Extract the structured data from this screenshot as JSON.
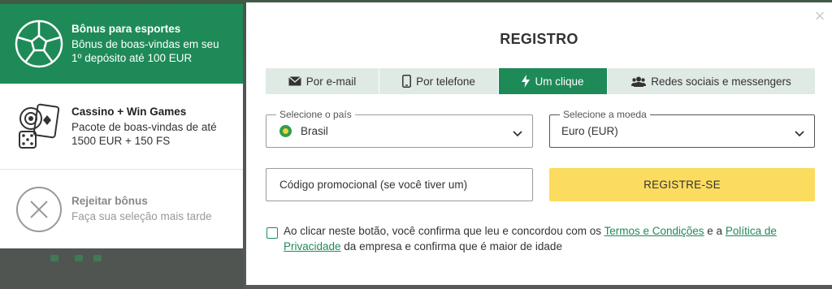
{
  "bonuses": [
    {
      "title": "Bônus para esportes",
      "desc_line1": "Bônus de boas-vindas em seu",
      "desc_line2": "1º depósito até 100 EUR",
      "icon": "soccer-ball-icon"
    },
    {
      "title": "Cassino + Win Games",
      "desc_line1": "Pacote de boas-vindas de até",
      "desc_line2": "1500 EUR + 150 FS",
      "icon": "casino-chips-icon"
    },
    {
      "title": "Rejeitar bônus",
      "desc_line1": "Faça sua seleção mais tarde",
      "icon": "close-circle-icon"
    }
  ],
  "modal": {
    "title": "REGISTRO",
    "close_icon": "×",
    "tabs": [
      {
        "label": "Por e-mail",
        "icon": "envelope-icon"
      },
      {
        "label": "Por telefone",
        "icon": "phone-icon"
      },
      {
        "label": "Um clique",
        "icon": "lightning-icon",
        "active": true
      },
      {
        "label": "Redes sociais e messengers",
        "icon": "users-icon"
      }
    ],
    "country": {
      "label": "Selecione o país",
      "value": "Brasil"
    },
    "currency": {
      "label": "Selecione a moeda",
      "value": "Euro (EUR)"
    },
    "promo_placeholder": "Código promocional (se você tiver um)",
    "register_label": "REGISTRE-SE",
    "terms": {
      "part1": "Ao clicar neste botão, você confirma que leu e concordou com os ",
      "link1": "Termos e Condições",
      "part2": " e a ",
      "link2": "Política de Privacidade",
      "part3": " da empresa e confirma que é maior de idade"
    }
  },
  "colors": {
    "brand_green": "#1e8a58",
    "register_yellow": "#fbdc5e",
    "tab_bg": "#dfeae5"
  }
}
